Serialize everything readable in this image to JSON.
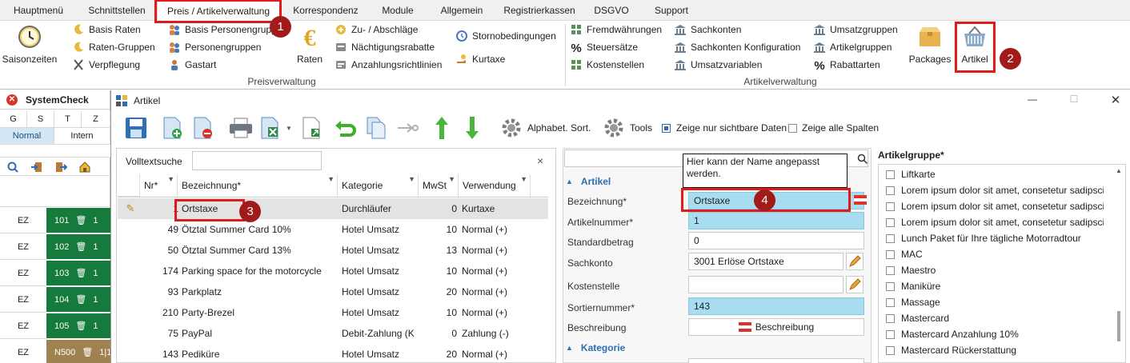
{
  "menubar": {
    "tabs": [
      "Hauptmenü",
      "Schnittstellen",
      "Preis / Artikelverwaltung",
      "Korrespondenz",
      "Module",
      "Allgemein",
      "Registrierkassen",
      "DSGVO",
      "Support"
    ],
    "active_index": 2
  },
  "ribbon": {
    "saisonzeiten": "Saisonzeiten",
    "col1": [
      "Basis Raten",
      "Raten-Gruppen",
      "Verpflegung"
    ],
    "col2": [
      "Basis Personengruppen",
      "Personengruppen",
      "Gastart"
    ],
    "raten": "Raten",
    "col3": [
      "Zu- / Abschläge",
      "Nächtigungsrabatte",
      "Anzahlungsrichtlinien"
    ],
    "col4": [
      "Stornobedingungen",
      "Kurtaxe"
    ],
    "group1": "Preisverwaltung",
    "col5": [
      "Fremdwährungen",
      "Steuersätze",
      "Kostenstellen"
    ],
    "col6": [
      "Sachkonten",
      "Sachkonten Konfiguration",
      "Umsatzvariablen"
    ],
    "col7": [
      "Umsatzgruppen",
      "Artikelgruppen",
      "Rabattarten"
    ],
    "packages": "Packages",
    "artikel": "Artikel",
    "group2": "Artikelverwaltung"
  },
  "badges": [
    "1",
    "2",
    "3",
    "4"
  ],
  "leftpanel": {
    "title": "SystemCheck",
    "cols": [
      "G",
      "S",
      "T",
      "Z"
    ],
    "modes": [
      "Normal",
      "Intern"
    ],
    "rows": [
      {
        "type": "EZ",
        "room": "101",
        "count": "1"
      },
      {
        "type": "EZ",
        "room": "102",
        "count": "1"
      },
      {
        "type": "EZ",
        "room": "103",
        "count": "1"
      },
      {
        "type": "EZ",
        "room": "104",
        "count": "1"
      },
      {
        "type": "EZ",
        "room": "105",
        "count": "1"
      },
      {
        "type": "EZ",
        "room": "N500",
        "count": "1|1"
      }
    ]
  },
  "window": {
    "title": "Artikel",
    "minimize": "—",
    "maximize": "☐",
    "close": "✕"
  },
  "toolbar": {
    "alpha_sort": "Alphabet. Sort.",
    "tools": "Tools",
    "show_visible": "Zeige nur sichtbare Daten",
    "show_all_cols": "Zeige alle Spalten"
  },
  "search": {
    "label": "Volltextsuche",
    "value": "",
    "clear": "×"
  },
  "grid": {
    "headers": [
      "Nr*",
      "Bezeichnung*",
      "Kategorie",
      "MwSt",
      "Verwendung"
    ],
    "rows": [
      {
        "nr": "1",
        "name": "Ortstaxe",
        "cat": "Durchläufer",
        "vat": "0",
        "use": "Kurtaxe"
      },
      {
        "nr": "49",
        "name": "Ötztal Summer Card 10%",
        "cat": "Hotel Umsatz",
        "vat": "10",
        "use": "Normal (+)"
      },
      {
        "nr": "50",
        "name": "Ötztal Summer Card 13%",
        "cat": "Hotel Umsatz",
        "vat": "13",
        "use": "Normal (+)"
      },
      {
        "nr": "174",
        "name": "Parking space for the motorcycle",
        "cat": "Hotel Umsatz",
        "vat": "10",
        "use": "Normal (+)"
      },
      {
        "nr": "93",
        "name": "Parkplatz",
        "cat": "Hotel Umsatz",
        "vat": "20",
        "use": "Normal (+)"
      },
      {
        "nr": "210",
        "name": "Party-Brezel",
        "cat": "Hotel Umsatz",
        "vat": "10",
        "use": "Normal (+)"
      },
      {
        "nr": "75",
        "name": "PayPal",
        "cat": "Debit-Zahlung (K",
        "vat": "0",
        "use": "Zahlung (-)"
      },
      {
        "nr": "143",
        "name": "Pediküre",
        "cat": "Hotel Umsatz",
        "vat": "20",
        "use": "Normal (+)"
      }
    ]
  },
  "detail": {
    "tooltip": "Hier kann der Name angepasst werden.",
    "section1": "Artikel",
    "section2": "Kategorie",
    "fields": {
      "bezeichnung_label": "Bezeichnung*",
      "bezeichnung_value": "Ortstaxe",
      "artikelnummer_label": "Artikelnummer*",
      "artikelnummer_value": "1",
      "standardbetrag_label": "Standardbetrag",
      "standardbetrag_value": "0",
      "sachkonto_label": "Sachkonto",
      "sachkonto_value": "3001 Erlöse Ortstaxe",
      "kostenstelle_label": "Kostenstelle",
      "kostenstelle_value": "",
      "sortiernummer_label": "Sortiernummer*",
      "sortiernummer_value": "143",
      "beschreibung_label": "Beschreibung",
      "beschreibung_button": "Beschreibung"
    }
  },
  "artikelgruppe": {
    "title": "Artikelgruppe*",
    "items": [
      "Liftkarte",
      "Lorem ipsum dolor sit amet, consetetur sadipscing",
      "Lorem ipsum dolor sit amet, consetetur sadipscing",
      "Lorem ipsum dolor sit amet, consetetur sadipscing",
      "Lunch Paket für Ihre tägliche Motorradtour",
      "MAC",
      "Maestro",
      "Maniküre",
      "Massage",
      "Mastercard",
      "Mastercard Anzahlung 10%",
      "Mastercard Rückerstattung"
    ]
  },
  "colors": {
    "accent": "#1f6fbf",
    "green": "#157a3c",
    "required": "#a8dcf0",
    "highlight": "#e21a1a",
    "badge": "#a11b1b"
  }
}
